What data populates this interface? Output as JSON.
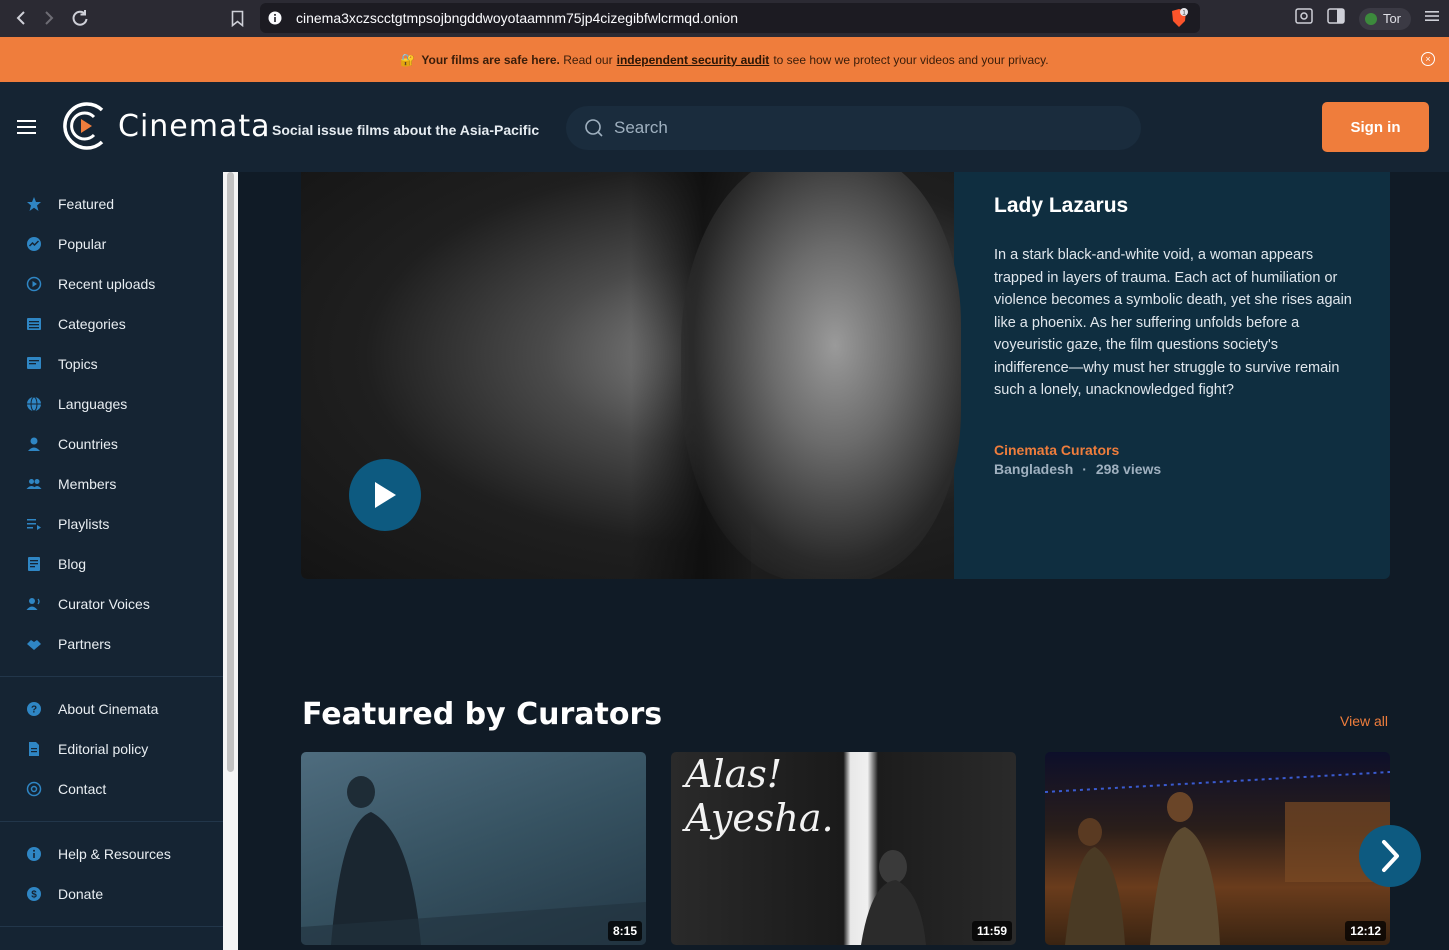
{
  "browser": {
    "url": "cinema3xczscctgtmpsojbngddwoyotaamnm75jp4cizegibfwlcrmqd.onion",
    "tor_label": "Tor",
    "brave_badge": "1"
  },
  "banner": {
    "emoji": "🔐",
    "bold_text": "Your films are safe here.",
    "text_before_link": "Read our",
    "link_text": "independent security audit",
    "text_after_link": "to see how we protect your videos and your privacy.",
    "close_label": "×"
  },
  "header": {
    "logo_text": "Cinemata",
    "tagline": "Social issue films about the Asia-Pacific",
    "search_placeholder": "Search",
    "signin_label": "Sign in"
  },
  "sidebar": {
    "items": [
      {
        "label": "Featured",
        "icon": "star-icon"
      },
      {
        "label": "Popular",
        "icon": "trending-icon"
      },
      {
        "label": "Recent uploads",
        "icon": "play-circle-icon"
      },
      {
        "label": "Categories",
        "icon": "list-icon"
      },
      {
        "label": "Topics",
        "icon": "topics-icon"
      },
      {
        "label": "Languages",
        "icon": "globe-icon"
      },
      {
        "label": "Countries",
        "icon": "location-icon"
      },
      {
        "label": "Members",
        "icon": "members-icon"
      },
      {
        "label": "Playlists",
        "icon": "playlist-icon"
      },
      {
        "label": "Blog",
        "icon": "blog-icon"
      },
      {
        "label": "Curator Voices",
        "icon": "voice-icon"
      },
      {
        "label": "Partners",
        "icon": "handshake-icon"
      }
    ],
    "about_items": [
      {
        "label": "About Cinemata",
        "icon": "help-icon"
      },
      {
        "label": "Editorial policy",
        "icon": "document-icon"
      },
      {
        "label": "Contact",
        "icon": "at-icon"
      }
    ],
    "support_items": [
      {
        "label": "Help & Resources",
        "icon": "info-icon"
      },
      {
        "label": "Donate",
        "icon": "donate-icon"
      }
    ]
  },
  "hero": {
    "title": "Lady Lazarus",
    "description": "In a stark black-and-white void, a woman appears trapped in layers of trauma. Each act of humiliation or violence becomes a symbolic death, yet she rises again like a phoenix. As her suffering unfolds before a voyeuristic gaze, the film questions society's indifference—why must her struggle to survive remain such a lonely, unacknowledged fight?",
    "curator": "Cinemata Curators",
    "country": "Bangladesh",
    "separator": "·",
    "views": "298 views"
  },
  "featured": {
    "title": "Featured by Curators",
    "view_all": "View all",
    "cards": [
      {
        "duration": "8:15"
      },
      {
        "duration": "11:59",
        "overlay_text": "Alas! Ayesha."
      },
      {
        "duration": "12:12"
      }
    ]
  },
  "colors": {
    "accent": "#ef7d3c",
    "header_bg": "#152433",
    "page_bg": "#101b26",
    "hero_panel": "#0f2e40",
    "play_button": "#0d5a80"
  }
}
